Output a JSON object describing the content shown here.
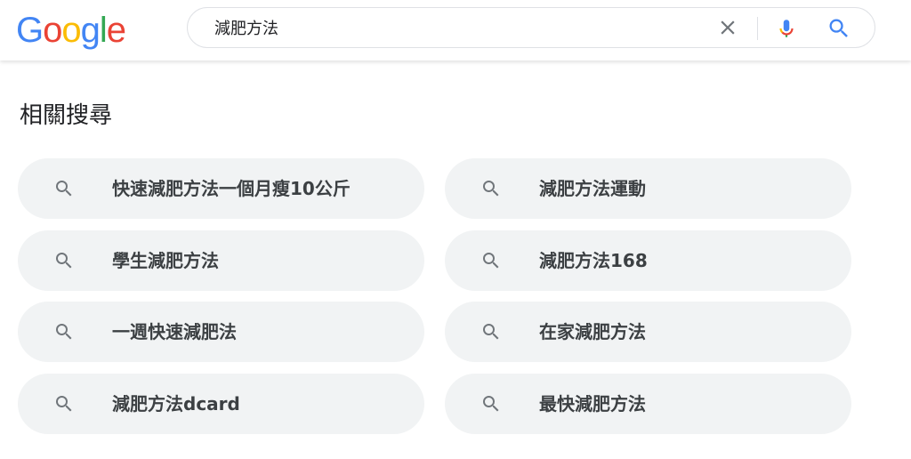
{
  "header": {
    "logo": {
      "letters": [
        "G",
        "o",
        "o",
        "g",
        "l",
        "e"
      ],
      "colors": [
        "#4285F4",
        "#EA4335",
        "#FBBC05",
        "#4285F4",
        "#34A853",
        "#EA4335"
      ]
    },
    "search": {
      "value": "減肥方法",
      "icons": {
        "clear": "close-icon",
        "voice": "microphone-icon",
        "submit": "search-icon"
      }
    }
  },
  "related": {
    "title": "相關搜尋",
    "items": [
      {
        "label": "快速減肥方法一個月瘦10公斤"
      },
      {
        "label": "減肥方法運動"
      },
      {
        "label": "學生減肥方法"
      },
      {
        "label": "減肥方法168"
      },
      {
        "label": "一週快速減肥法"
      },
      {
        "label": "在家減肥方法"
      },
      {
        "label": "減肥方法dcard"
      },
      {
        "label": "最快減肥方法"
      }
    ]
  },
  "colors": {
    "chip_bg": "#f1f3f4",
    "text": "#3c4043",
    "icon_grey": "#70757a",
    "search_blue": "#4285F4"
  }
}
